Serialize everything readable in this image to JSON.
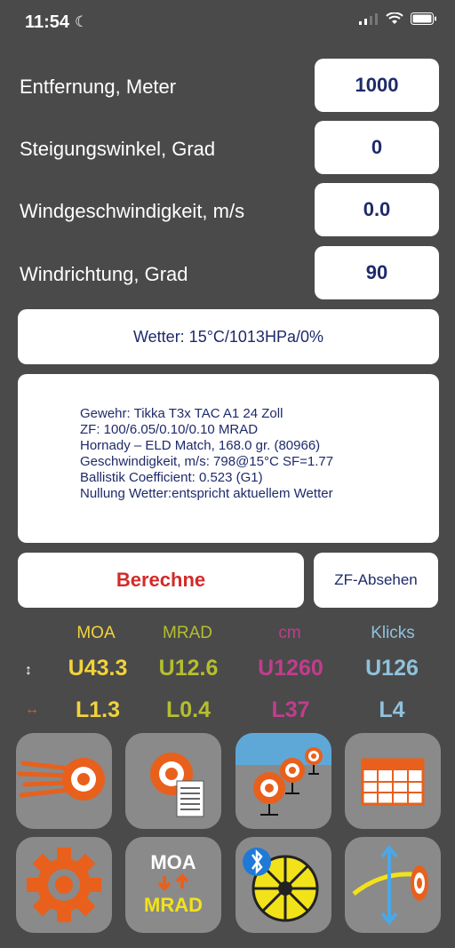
{
  "status": {
    "time": "11:54"
  },
  "inputs": [
    {
      "label": "Entfernung, Meter",
      "value": "1000"
    },
    {
      "label": "Steigungswinkel, Grad",
      "value": "0"
    },
    {
      "label": "Windgeschwindigkeit, m/s",
      "value": "0.0"
    },
    {
      "label": "Windrichtung, Grad",
      "value": "90"
    }
  ],
  "weather": "Wetter: 15°C/1013HPa/0%",
  "info": [
    "Gewehr: Tikka T3x TAC A1 24 Zoll",
    "ZF: 100/6.05/0.10/0.10 MRAD",
    "Hornady – ELD Match, 168.0 gr. (80966)",
    "Geschwindigkeit, m/s: 798@15°C SF=1.77",
    "Ballistik Coefficient: 0.523 (G1)",
    "Nullung Wetter:entspricht aktuellem Wetter"
  ],
  "buttons": {
    "calc": "Berechne",
    "zf": "ZF-Absehen"
  },
  "results": {
    "headers": [
      "MOA",
      "MRAD",
      "cm",
      "Klicks"
    ],
    "vertical": [
      "U43.3",
      "U12.6",
      "U1260",
      "U126"
    ],
    "horizontal": [
      "L1.3",
      "L0.4",
      "L37",
      "L4"
    ],
    "vertical_icon": "↕",
    "horizontal_icon": "↔"
  },
  "tiles": {
    "moa_label": "MOA",
    "mrad_label": "MRAD"
  },
  "colors": {
    "moa": "#f2d33a",
    "mrad": "#b5bf2e",
    "cm": "#c23c8e",
    "klicks": "#8fc2dc",
    "orange": "#e8601c",
    "navy": "#1e2a6b",
    "red": "#d32a2a"
  }
}
